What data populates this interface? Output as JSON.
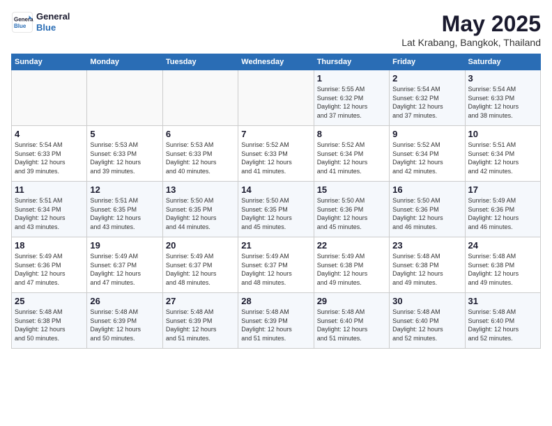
{
  "header": {
    "logo_line1": "General",
    "logo_line2": "Blue",
    "title": "May 2025",
    "subtitle": "Lat Krabang, Bangkok, Thailand"
  },
  "calendar": {
    "days_of_week": [
      "Sunday",
      "Monday",
      "Tuesday",
      "Wednesday",
      "Thursday",
      "Friday",
      "Saturday"
    ],
    "weeks": [
      [
        {
          "day": "",
          "info": ""
        },
        {
          "day": "",
          "info": ""
        },
        {
          "day": "",
          "info": ""
        },
        {
          "day": "",
          "info": ""
        },
        {
          "day": "1",
          "info": "Sunrise: 5:55 AM\nSunset: 6:32 PM\nDaylight: 12 hours\nand 37 minutes."
        },
        {
          "day": "2",
          "info": "Sunrise: 5:54 AM\nSunset: 6:32 PM\nDaylight: 12 hours\nand 37 minutes."
        },
        {
          "day": "3",
          "info": "Sunrise: 5:54 AM\nSunset: 6:33 PM\nDaylight: 12 hours\nand 38 minutes."
        }
      ],
      [
        {
          "day": "4",
          "info": "Sunrise: 5:54 AM\nSunset: 6:33 PM\nDaylight: 12 hours\nand 39 minutes."
        },
        {
          "day": "5",
          "info": "Sunrise: 5:53 AM\nSunset: 6:33 PM\nDaylight: 12 hours\nand 39 minutes."
        },
        {
          "day": "6",
          "info": "Sunrise: 5:53 AM\nSunset: 6:33 PM\nDaylight: 12 hours\nand 40 minutes."
        },
        {
          "day": "7",
          "info": "Sunrise: 5:52 AM\nSunset: 6:33 PM\nDaylight: 12 hours\nand 41 minutes."
        },
        {
          "day": "8",
          "info": "Sunrise: 5:52 AM\nSunset: 6:34 PM\nDaylight: 12 hours\nand 41 minutes."
        },
        {
          "day": "9",
          "info": "Sunrise: 5:52 AM\nSunset: 6:34 PM\nDaylight: 12 hours\nand 42 minutes."
        },
        {
          "day": "10",
          "info": "Sunrise: 5:51 AM\nSunset: 6:34 PM\nDaylight: 12 hours\nand 42 minutes."
        }
      ],
      [
        {
          "day": "11",
          "info": "Sunrise: 5:51 AM\nSunset: 6:34 PM\nDaylight: 12 hours\nand 43 minutes."
        },
        {
          "day": "12",
          "info": "Sunrise: 5:51 AM\nSunset: 6:35 PM\nDaylight: 12 hours\nand 43 minutes."
        },
        {
          "day": "13",
          "info": "Sunrise: 5:50 AM\nSunset: 6:35 PM\nDaylight: 12 hours\nand 44 minutes."
        },
        {
          "day": "14",
          "info": "Sunrise: 5:50 AM\nSunset: 6:35 PM\nDaylight: 12 hours\nand 45 minutes."
        },
        {
          "day": "15",
          "info": "Sunrise: 5:50 AM\nSunset: 6:36 PM\nDaylight: 12 hours\nand 45 minutes."
        },
        {
          "day": "16",
          "info": "Sunrise: 5:50 AM\nSunset: 6:36 PM\nDaylight: 12 hours\nand 46 minutes."
        },
        {
          "day": "17",
          "info": "Sunrise: 5:49 AM\nSunset: 6:36 PM\nDaylight: 12 hours\nand 46 minutes."
        }
      ],
      [
        {
          "day": "18",
          "info": "Sunrise: 5:49 AM\nSunset: 6:36 PM\nDaylight: 12 hours\nand 47 minutes."
        },
        {
          "day": "19",
          "info": "Sunrise: 5:49 AM\nSunset: 6:37 PM\nDaylight: 12 hours\nand 47 minutes."
        },
        {
          "day": "20",
          "info": "Sunrise: 5:49 AM\nSunset: 6:37 PM\nDaylight: 12 hours\nand 48 minutes."
        },
        {
          "day": "21",
          "info": "Sunrise: 5:49 AM\nSunset: 6:37 PM\nDaylight: 12 hours\nand 48 minutes."
        },
        {
          "day": "22",
          "info": "Sunrise: 5:49 AM\nSunset: 6:38 PM\nDaylight: 12 hours\nand 49 minutes."
        },
        {
          "day": "23",
          "info": "Sunrise: 5:48 AM\nSunset: 6:38 PM\nDaylight: 12 hours\nand 49 minutes."
        },
        {
          "day": "24",
          "info": "Sunrise: 5:48 AM\nSunset: 6:38 PM\nDaylight: 12 hours\nand 49 minutes."
        }
      ],
      [
        {
          "day": "25",
          "info": "Sunrise: 5:48 AM\nSunset: 6:38 PM\nDaylight: 12 hours\nand 50 minutes."
        },
        {
          "day": "26",
          "info": "Sunrise: 5:48 AM\nSunset: 6:39 PM\nDaylight: 12 hours\nand 50 minutes."
        },
        {
          "day": "27",
          "info": "Sunrise: 5:48 AM\nSunset: 6:39 PM\nDaylight: 12 hours\nand 51 minutes."
        },
        {
          "day": "28",
          "info": "Sunrise: 5:48 AM\nSunset: 6:39 PM\nDaylight: 12 hours\nand 51 minutes."
        },
        {
          "day": "29",
          "info": "Sunrise: 5:48 AM\nSunset: 6:40 PM\nDaylight: 12 hours\nand 51 minutes."
        },
        {
          "day": "30",
          "info": "Sunrise: 5:48 AM\nSunset: 6:40 PM\nDaylight: 12 hours\nand 52 minutes."
        },
        {
          "day": "31",
          "info": "Sunrise: 5:48 AM\nSunset: 6:40 PM\nDaylight: 12 hours\nand 52 minutes."
        }
      ]
    ]
  }
}
